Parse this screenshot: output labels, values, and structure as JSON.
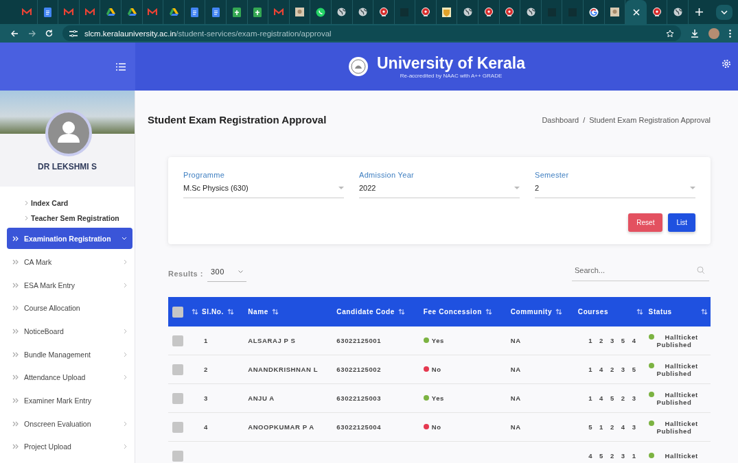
{
  "browser": {
    "tabs": [
      {
        "kind": "gmail",
        "selected": false
      },
      {
        "kind": "docs",
        "selected": false
      },
      {
        "kind": "gmail",
        "selected": false
      },
      {
        "kind": "gmail",
        "selected": false
      },
      {
        "kind": "drive",
        "selected": false
      },
      {
        "kind": "drive",
        "selected": false
      },
      {
        "kind": "gmail",
        "selected": false
      },
      {
        "kind": "drive",
        "selected": false
      },
      {
        "kind": "docs",
        "selected": false
      },
      {
        "kind": "docs",
        "selected": false
      },
      {
        "kind": "sheets",
        "selected": false
      },
      {
        "kind": "sheets",
        "selected": false
      },
      {
        "kind": "gmail",
        "selected": false
      },
      {
        "kind": "image",
        "selected": false
      },
      {
        "kind": "whatsapp",
        "selected": false
      },
      {
        "kind": "globe",
        "selected": false
      },
      {
        "kind": "globe",
        "selected": false
      },
      {
        "kind": "seal",
        "selected": false
      },
      {
        "kind": "dark",
        "selected": false
      },
      {
        "kind": "seal",
        "selected": false
      },
      {
        "kind": "crest",
        "selected": false
      },
      {
        "kind": "globe",
        "selected": false
      },
      {
        "kind": "seal",
        "selected": false
      },
      {
        "kind": "seal",
        "selected": false
      },
      {
        "kind": "globe",
        "selected": false
      },
      {
        "kind": "dark",
        "selected": false
      },
      {
        "kind": "dark",
        "selected": false
      },
      {
        "kind": "google",
        "selected": false
      },
      {
        "kind": "image",
        "selected": false
      },
      {
        "kind": "blank",
        "selected": true
      },
      {
        "kind": "seal",
        "selected": false
      },
      {
        "kind": "globe",
        "selected": false
      }
    ],
    "url_host": "slcm.keralauniversity.ac.in",
    "url_path": "/student-services/exam-registration/approval"
  },
  "header": {
    "title": "University of Kerala",
    "subtitle": "Re-accredited by NAAC with A++ GRADE"
  },
  "sidebar": {
    "user_name": "DR LEKSHMI S",
    "sub_items": [
      {
        "label": "Index Card"
      },
      {
        "label": "Teacher Sem Registration"
      }
    ],
    "items": [
      {
        "label": "Examination Registration",
        "selected": true,
        "kind": "open"
      },
      {
        "label": "CA Mark",
        "selected": false,
        "kind": "closed"
      },
      {
        "label": "ESA Mark Entry",
        "selected": false,
        "kind": "closed"
      },
      {
        "label": "Course Allocation",
        "selected": false,
        "kind": "link"
      },
      {
        "label": "NoticeBoard",
        "selected": false,
        "kind": "closed"
      },
      {
        "label": "Bundle Management",
        "selected": false,
        "kind": "closed"
      },
      {
        "label": "Attendance Upload",
        "selected": false,
        "kind": "closed"
      },
      {
        "label": "Examiner Mark Entry",
        "selected": false,
        "kind": "link"
      },
      {
        "label": "Onscreen Evaluation",
        "selected": false,
        "kind": "closed"
      },
      {
        "label": "Project Upload",
        "selected": false,
        "kind": "closed"
      }
    ]
  },
  "page": {
    "title": "Student Exam Registration Approval",
    "breadcrumb": [
      "Dashboard",
      "/",
      "Student Exam Registration Approval"
    ]
  },
  "filters": [
    {
      "label": "Programme",
      "value": "M.Sc Physics (630)"
    },
    {
      "label": "Admission Year",
      "value": "2022"
    },
    {
      "label": "Semester",
      "value": "2"
    }
  ],
  "buttons": [
    {
      "label": "Reset",
      "kind": "danger"
    },
    {
      "label": "List",
      "kind": "primary"
    }
  ],
  "results": {
    "label": "Results :",
    "value": "300"
  },
  "search": {
    "placeholder": "Search..."
  },
  "table": {
    "all_checked": false,
    "columns": [
      {
        "label": "Sl.No."
      },
      {
        "label": "Name"
      },
      {
        "label": "Candidate Code"
      },
      {
        "label": "Fee Concession"
      },
      {
        "label": "Community"
      },
      {
        "label": "Courses"
      },
      {
        "label": "Status"
      }
    ],
    "rows": [
      {
        "checked": false,
        "sl_no": "1",
        "name": "ALSARAJ P S",
        "code": "63022125001",
        "fee": {
          "text": "Yes",
          "color": "#7cb342"
        },
        "community": "NA",
        "courses": [
          "1",
          "2",
          "3",
          "5",
          "4"
        ],
        "status": {
          "lines": [
            "Hallticket",
            "Published"
          ],
          "color": "#7cb342"
        }
      },
      {
        "checked": false,
        "sl_no": "2",
        "name": "ANANDKRISHNAN L",
        "code": "63022125002",
        "fee": {
          "text": "No",
          "color": "#e53950"
        },
        "community": "NA",
        "courses": [
          "1",
          "4",
          "2",
          "3",
          "5"
        ],
        "status": {
          "lines": [
            "Hallticket",
            "Published"
          ],
          "color": "#7cb342"
        }
      },
      {
        "checked": false,
        "sl_no": "3",
        "name": "ANJU A",
        "code": "63022125003",
        "fee": {
          "text": "Yes",
          "color": "#7cb342"
        },
        "community": "NA",
        "courses": [
          "1",
          "4",
          "5",
          "2",
          "3"
        ],
        "status": {
          "lines": [
            "Hallticket",
            "Published"
          ],
          "color": "#7cb342"
        }
      },
      {
        "checked": false,
        "sl_no": "4",
        "name": "ANOOPKUMAR P A",
        "code": "63022125004",
        "fee": {
          "text": "No",
          "color": "#e53950"
        },
        "community": "NA",
        "courses": [
          "5",
          "1",
          "2",
          "4",
          "3"
        ],
        "status": {
          "lines": [
            "Hallticket",
            "Published"
          ],
          "color": "#7cb342"
        }
      },
      {
        "checked": false,
        "courses": [
          "4",
          "5",
          "2",
          "3",
          "1"
        ],
        "status": {
          "lines": [
            "Hallticket"
          ],
          "color": "#7cb342"
        }
      }
    ]
  }
}
